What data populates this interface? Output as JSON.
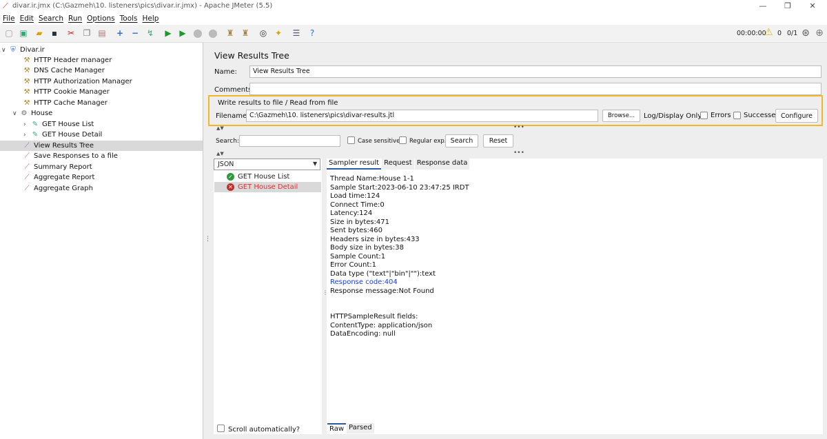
{
  "window": {
    "title": "divar.ir.jmx (C:\\Gazmeh\\10. listeners\\pics\\divar.ir.jmx) - Apache JMeter (5.5)",
    "minimize": "—",
    "maximize": "❐",
    "close": "✕"
  },
  "menu": [
    "File",
    "Edit",
    "Search",
    "Run",
    "Options",
    "Tools",
    "Help"
  ],
  "toolbar": {
    "timer": "00:00:00",
    "warning_count": "0",
    "threads": "0/1"
  },
  "tree": {
    "root": "Divar.ir",
    "items": [
      {
        "label": "HTTP Header manager"
      },
      {
        "label": "DNS Cache Manager"
      },
      {
        "label": "HTTP Authorization Manager"
      },
      {
        "label": "HTTP Cookie Manager"
      },
      {
        "label": "HTTP Cache Manager"
      },
      {
        "label": "House"
      },
      {
        "label": "GET House List"
      },
      {
        "label": "GET House Detail"
      },
      {
        "label": "View Results Tree"
      },
      {
        "label": "Save Responses to a file"
      },
      {
        "label": "Summary Report"
      },
      {
        "label": "Aggregate Report"
      },
      {
        "label": "Aggregate Graph"
      }
    ]
  },
  "panel": {
    "title": "View Results Tree",
    "name_label": "Name:",
    "name_value": "View Results Tree",
    "comments_label": "Comments:",
    "comments_value": "",
    "file_section_title": "Write results to file / Read from file",
    "filename_label": "Filename",
    "filename_value": "C:\\Gazmeh\\10. listeners\\pics\\divar-results.jtl",
    "browse_label": "Browse...",
    "log_display_label": "Log/Display Only:",
    "errors_label": "Errors",
    "successes_label": "Successes",
    "configure_label": "Configure"
  },
  "search": {
    "label": "Search:",
    "value": "",
    "case_sensitive_label": "Case sensitive",
    "regex_label": "Regular exp.",
    "search_button": "Search",
    "reset_button": "Reset"
  },
  "renderer": {
    "selected": "JSON",
    "samples": [
      {
        "label": "GET House List",
        "status": "success"
      },
      {
        "label": "GET House Detail",
        "status": "error"
      }
    ],
    "scroll_auto_label": "Scroll automatically?"
  },
  "result_tabs": [
    "Sampler result",
    "Request",
    "Response data"
  ],
  "result_lines": [
    "Thread Name:House 1-1",
    "Sample Start:2023-06-10 23:47:25 IRDT",
    "Load time:124",
    "Connect Time:0",
    "Latency:124",
    "Size in bytes:471",
    "Sent bytes:460",
    "Headers size in bytes:433",
    "Body size in bytes:38",
    "Sample Count:1",
    "Error Count:1",
    "Data type (\"text\"|\"bin\"|\"\"):text",
    "Response code:404",
    "Response message:Not Found",
    "",
    "",
    "HTTPSampleResult fields:",
    "ContentType: application/json",
    "DataEncoding: null"
  ],
  "bottom_tabs": [
    "Raw",
    "Parsed"
  ],
  "colors": {
    "highlight": "#f2b52b",
    "error_text": "#e03030",
    "link_blue": "#1a3fd0",
    "success_green": "#2a9a3a"
  }
}
